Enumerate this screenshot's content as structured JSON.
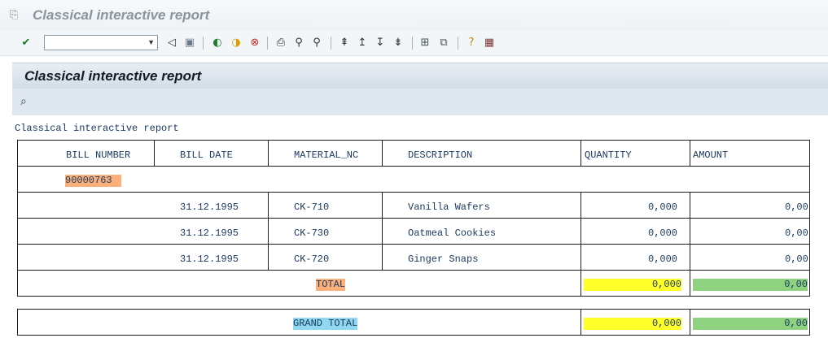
{
  "window": {
    "title": "Classical interactive report"
  },
  "toolbar": {
    "command_field_value": "",
    "icons": [
      "checkmark-icon",
      "back-icon",
      "save-icon",
      "back-green-icon",
      "exit-icon",
      "cancel-icon",
      "print-icon",
      "find-icon",
      "find-next-icon",
      "first-page-icon",
      "previous-page-icon",
      "next-page-icon",
      "last-page-icon",
      "create-session-icon",
      "shortcut-icon",
      "help-icon",
      "layout-icon"
    ]
  },
  "screen": {
    "title": "Classical interactive report"
  },
  "report": {
    "heading": "Classical interactive report",
    "columns": [
      "BILL NUMBER",
      "BILL DATE",
      "MATERIAL_NC",
      "DESCRIPTION",
      "QUANTITY",
      "AMOUNT"
    ],
    "bill_number": "90000763",
    "rows": [
      {
        "date": "31.12.1995",
        "material": "CK-710",
        "description": "Vanilla Wafers",
        "quantity": "0,000",
        "amount": "0,00"
      },
      {
        "date": "31.12.1995",
        "material": "CK-730",
        "description": "Oatmeal Cookies",
        "quantity": "0,000",
        "amount": "0,00"
      },
      {
        "date": "31.12.1995",
        "material": "CK-720",
        "description": "Ginger Snaps",
        "quantity": "0,000",
        "amount": "0,00"
      }
    ],
    "total": {
      "label": "TOTAL",
      "quantity": "0,000",
      "amount": "0,00"
    },
    "grand_total": {
      "label": "GRAND TOTAL",
      "quantity": "0,000",
      "amount": "0,00"
    }
  },
  "colors": {
    "highlight_orange": "#fbb07a",
    "highlight_yellow": "#ffff2a",
    "highlight_green": "#8ed17f",
    "highlight_cyan": "#8fd8ef"
  }
}
